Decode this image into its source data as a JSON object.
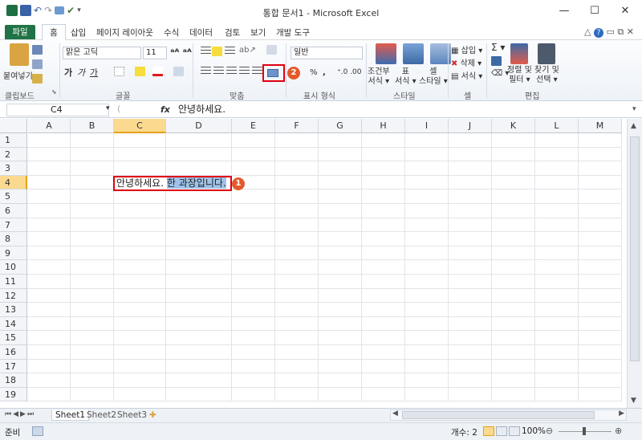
{
  "window": {
    "title": "통합 문서1 - Microsoft Excel",
    "minimize": "—",
    "maximize": "☐",
    "close": "✕"
  },
  "tabs": {
    "file": "파일",
    "home": "홈",
    "items": [
      "삽입",
      "페이지 레이아웃",
      "수식",
      "데이터",
      "검토",
      "보기",
      "개발 도구"
    ]
  },
  "ribbon": {
    "clipboard": {
      "paste": "붙여넣기",
      "label": "클립보드"
    },
    "font": {
      "name": "맑은 고딕",
      "size": "11",
      "bold": "가",
      "italic": "가",
      "underline": "가",
      "label": "글꼴"
    },
    "align": {
      "label": "맞춤"
    },
    "number": {
      "format": "일반",
      "percent": "%",
      "comma": ",",
      "label": "표시 형식"
    },
    "styles": {
      "cond": "조건부\n서식",
      "table": "표\n서식",
      "cell": "셀\n스타일",
      "cond1": "조건부",
      "cond2": "서식 ▾",
      "table1": "표",
      "table2": "서식 ▾",
      "cell1": "셀",
      "cell2": "스타일 ▾",
      "label": "스타일"
    },
    "cells": {
      "insert": "삽입 ▾",
      "delete": "삭제 ▾",
      "format": "서식 ▾",
      "label": "셀"
    },
    "edit": {
      "sum": "Σ ▾",
      "sort1": "정렬 및",
      "sort2": "필터 ▾",
      "find1": "찾기 및",
      "find2": "선택 ▾",
      "label": "편집"
    }
  },
  "formula_bar": {
    "name_box": "C4",
    "fx": "fx",
    "content": "안녕하세요."
  },
  "sheet": {
    "columns": [
      "A",
      "B",
      "C",
      "D",
      "E",
      "F",
      "G",
      "H",
      "I",
      "J",
      "K",
      "L",
      "M"
    ],
    "selected_column": "C",
    "rows": [
      "1",
      "2",
      "3",
      "4",
      "5",
      "6",
      "7",
      "8",
      "9",
      "10",
      "11",
      "12",
      "13",
      "14",
      "15",
      "16",
      "17",
      "18",
      "19"
    ],
    "selected_row": "4",
    "active_cell": "C4",
    "cell_text_plain": "안녕하세요. ",
    "cell_text_selected": "한 과장입니다."
  },
  "annotations": {
    "badge1": "1",
    "badge2": "2"
  },
  "sheet_tabs": [
    "Sheet1",
    "Sheet2",
    "Sheet3"
  ],
  "status": {
    "mode": "준비",
    "count": "개수: 2",
    "zoom": "100%"
  },
  "colors": {
    "excel_green": "#207346",
    "highlight_red": "#e0000e",
    "badge_orange": "#e35a2c",
    "selection_blue": "#9fc3ea",
    "header_selected": "#fbd98f"
  }
}
